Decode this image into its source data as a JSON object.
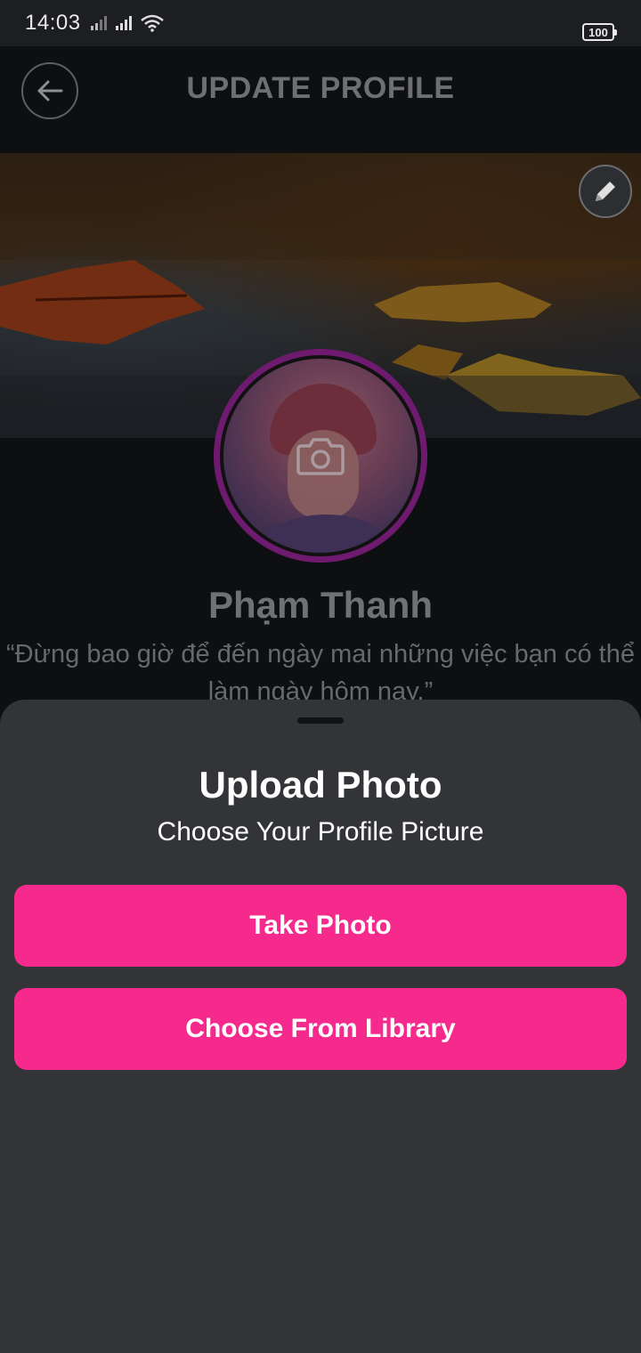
{
  "status_bar": {
    "time": "14:03",
    "battery": "100",
    "icons": [
      "signal-icon",
      "signal-icon",
      "wifi-icon",
      "battery-icon"
    ]
  },
  "header": {
    "title": "UPDATE PROFILE",
    "back_icon": "arrow-left-icon"
  },
  "profile": {
    "name": "Phạm Thanh",
    "quote": "“Đừng bao giờ để đến ngày mai những việc bạn có thể làm ngày hôm nay.”",
    "edit_cover_icon": "pencil-icon",
    "avatar_overlay_icon": "camera-icon"
  },
  "sheet": {
    "title": "Upload Photo",
    "subtitle": "Choose Your Profile Picture",
    "take_photo_label": "Take Photo",
    "choose_library_label": "Choose From Library"
  },
  "colors": {
    "accent": "#f52a8c",
    "sheet_bg": "#333437",
    "page_bg": "#0e0f11",
    "avatar_ring": "#6e1a6f"
  }
}
